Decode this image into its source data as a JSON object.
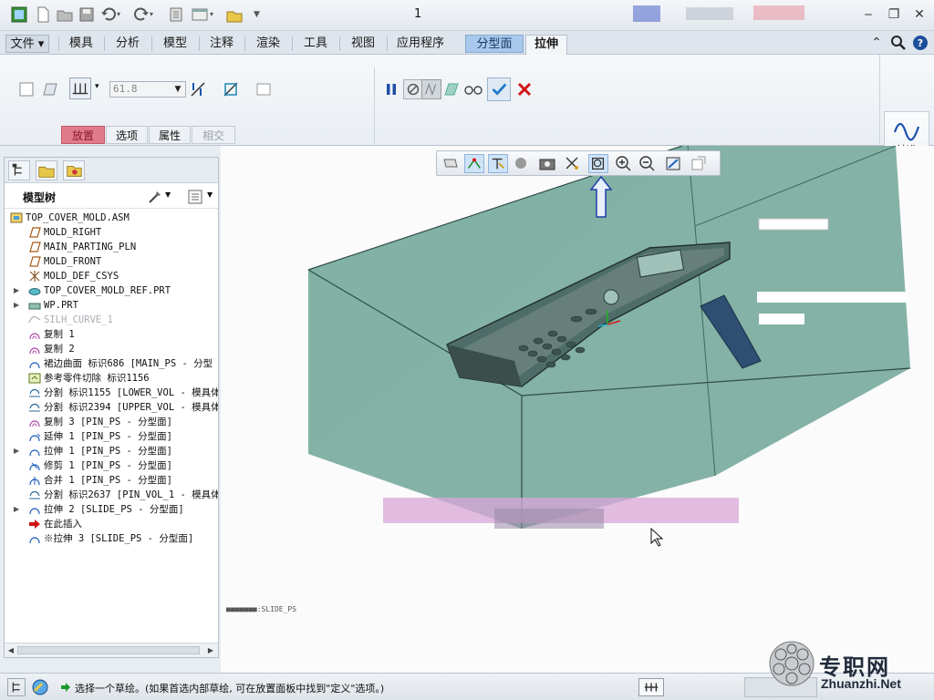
{
  "window": {
    "title": "1"
  },
  "tabs": [
    {
      "label": "文件"
    },
    {
      "label": "模具"
    },
    {
      "label": "分析"
    },
    {
      "label": "模型"
    },
    {
      "label": "注释"
    },
    {
      "label": "渲染"
    },
    {
      "label": "工具"
    },
    {
      "label": "视图"
    },
    {
      "label": "应用程序"
    },
    {
      "label": "分型面"
    },
    {
      "label": "拉伸"
    }
  ],
  "ribbon": {
    "depth_value": "61.8",
    "subtabs": [
      {
        "label": "放置",
        "state": "active"
      },
      {
        "label": "选项",
        "state": "normal"
      },
      {
        "label": "属性",
        "state": "normal"
      },
      {
        "label": "相交",
        "state": "disabled"
      }
    ],
    "datum_label": "基准"
  },
  "model_tree": {
    "title": "模型树",
    "items": [
      {
        "label": "TOP_COVER_MOLD.ASM",
        "icon": "assembly-icon",
        "expand": ""
      },
      {
        "label": "MOLD_RIGHT",
        "icon": "datum-plane-icon",
        "expand": ""
      },
      {
        "label": "MAIN_PARTING_PLN",
        "icon": "datum-plane-icon",
        "expand": ""
      },
      {
        "label": "MOLD_FRONT",
        "icon": "datum-plane-icon",
        "expand": ""
      },
      {
        "label": "MOLD_DEF_CSYS",
        "icon": "csys-icon",
        "expand": ""
      },
      {
        "label": "TOP_COVER_MOLD_REF.PRT",
        "icon": "part-icon",
        "expand": "▶"
      },
      {
        "label": "WP.PRT",
        "icon": "workpiece-icon",
        "expand": "▶"
      },
      {
        "label": "SILH_CURVE_1",
        "icon": "curve-icon",
        "expand": "",
        "dim": true
      },
      {
        "label": "复制 1",
        "icon": "copy-surface-icon",
        "expand": ""
      },
      {
        "label": "复制 2",
        "icon": "copy-surface-icon",
        "expand": ""
      },
      {
        "label": "裙边曲面 标识686 [MAIN_PS - 分型",
        "icon": "skirt-surface-icon",
        "expand": ""
      },
      {
        "label": "参考零件切除 标识1156",
        "icon": "ref-cut-icon",
        "expand": ""
      },
      {
        "label": "分割 标识1155 [LOWER_VOL - 模具体",
        "icon": "split-icon",
        "expand": ""
      },
      {
        "label": "分割 标识2394 [UPPER_VOL - 模具体",
        "icon": "split-icon",
        "expand": ""
      },
      {
        "label": "复制 3 [PIN_PS - 分型面]",
        "icon": "copy-surface-icon",
        "expand": ""
      },
      {
        "label": "延伸 1 [PIN_PS - 分型面]",
        "icon": "extend-icon",
        "expand": ""
      },
      {
        "label": "拉伸 1 [PIN_PS - 分型面]",
        "icon": "extrude-icon",
        "expand": "▶"
      },
      {
        "label": "修剪 1 [PIN_PS - 分型面]",
        "icon": "trim-icon",
        "expand": ""
      },
      {
        "label": "合并 1 [PIN_PS - 分型面]",
        "icon": "merge-icon",
        "expand": ""
      },
      {
        "label": "分割 标识2637 [PIN_VOL_1 - 模具体",
        "icon": "split-icon",
        "expand": ""
      },
      {
        "label": "拉伸 2 [SLIDE_PS - 分型面]",
        "icon": "extrude-icon",
        "expand": "▶"
      },
      {
        "label": "在此插入",
        "icon": "insert-here-icon",
        "expand": ""
      },
      {
        "label": "※拉伸 3 [SLIDE_PS - 分型面]",
        "icon": "extrude-icon",
        "expand": ""
      }
    ]
  },
  "viewport": {
    "caption": "■■■■■■■:SLIDE_PS"
  },
  "status": {
    "message": "选择一个草绘。(如果首选内部草绘, 可在放置面板中找到\"定义\"选项。)"
  },
  "watermark": {
    "text": "专职网",
    "url": "Zhuanzhi.Net"
  },
  "colors": {
    "accent": "#3a7bd5",
    "active_subtab": "#e07b8a",
    "mold_volume": "#5f9a8c"
  }
}
